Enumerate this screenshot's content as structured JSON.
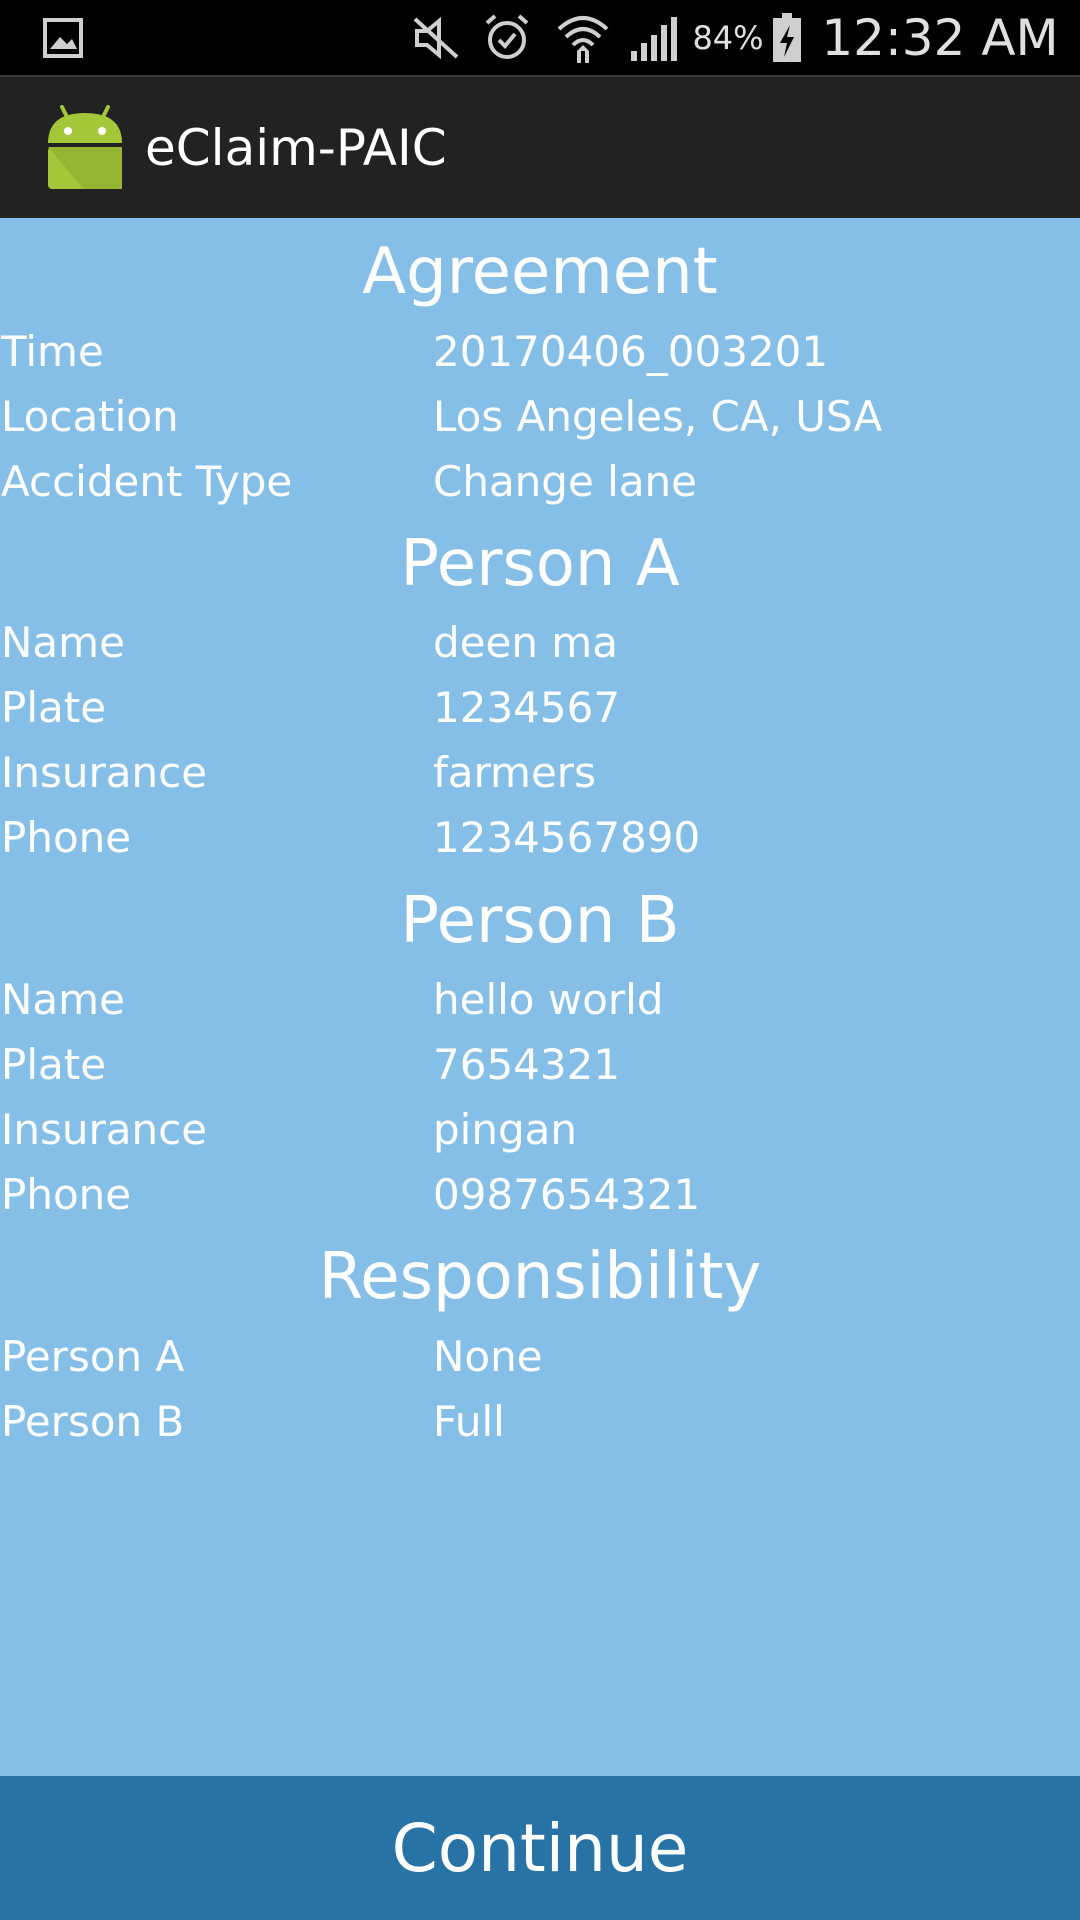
{
  "status_bar": {
    "battery_percent": "84%",
    "time": "12:32 AM",
    "icons": [
      "gallery-notification-icon",
      "mute-icon",
      "alarm-icon",
      "wifi-icon",
      "signal-icon",
      "battery-charging-icon"
    ]
  },
  "app_bar": {
    "title": "eClaim-PAIC",
    "icon": "android-app-icon"
  },
  "agreement": {
    "heading": "Agreement",
    "rows": [
      {
        "label": "Time",
        "value": "20170406_003201"
      },
      {
        "label": "Location",
        "value": "Los Angeles, CA, USA"
      },
      {
        "label": "Accident Type",
        "value": "Change lane"
      }
    ]
  },
  "person_a": {
    "heading": "Person A",
    "rows": [
      {
        "label": "Name",
        "value": "deen ma"
      },
      {
        "label": "Plate",
        "value": "1234567"
      },
      {
        "label": "Insurance",
        "value": "farmers"
      },
      {
        "label": "Phone",
        "value": "1234567890"
      }
    ]
  },
  "person_b": {
    "heading": "Person B",
    "rows": [
      {
        "label": "Name",
        "value": "hello world"
      },
      {
        "label": "Plate",
        "value": "7654321"
      },
      {
        "label": "Insurance",
        "value": "pingan"
      },
      {
        "label": "Phone",
        "value": "0987654321"
      }
    ]
  },
  "responsibility": {
    "heading": "Responsibility",
    "rows": [
      {
        "label": "Person A",
        "value": "None"
      },
      {
        "label": "Person B",
        "value": "Full"
      }
    ]
  },
  "continue_button": {
    "label": "Continue"
  },
  "colors": {
    "status_bar": "#000000",
    "action_bar": "#222222",
    "content_background": "#85bfe7",
    "button_background": "#2873a6",
    "android_green": "#a4c639"
  }
}
